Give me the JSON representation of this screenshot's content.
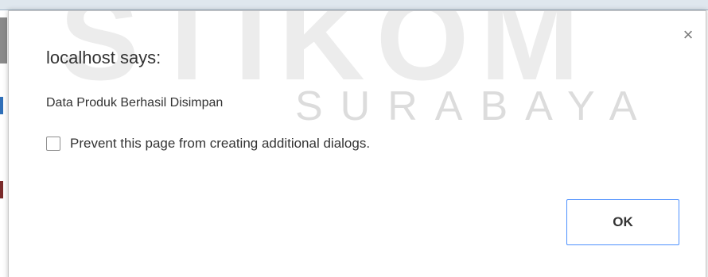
{
  "watermark": {
    "big_text": "STIKOM",
    "small_text": "SURABAYA"
  },
  "dialog": {
    "title": "localhost says:",
    "message": "Data Produk Berhasil Disimpan",
    "close_glyph": "×",
    "close_icon": "close-icon",
    "prevent_label": "Prevent this page from creating additional dialogs.",
    "prevent_checked": false,
    "ok_label": "OK",
    "accent_color": "#4d90fe"
  }
}
